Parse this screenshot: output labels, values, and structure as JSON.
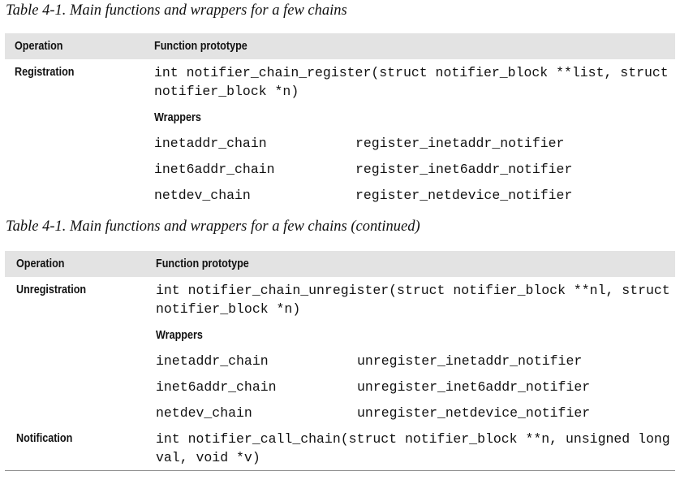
{
  "table1": {
    "caption": "Table 4-1. Main functions and wrappers for a few chains",
    "header": {
      "operation": "Operation",
      "prototype": "Function prototype"
    },
    "rows": [
      {
        "operation": "Registration",
        "prototype_line1": "int notifier_chain_register(struct notifier_block **list, struct",
        "prototype_line2": "notifier_block *n)",
        "wrappers_label": "Wrappers",
        "wrappers": [
          {
            "chain": "inetaddr_chain",
            "function": "register_inetaddr_notifier"
          },
          {
            "chain": "inet6addr_chain",
            "function": "register_inet6addr_notifier"
          },
          {
            "chain": "netdev_chain",
            "function": "register_netdevice_notifier"
          }
        ]
      }
    ]
  },
  "table2": {
    "caption": "Table 4-1. Main functions and wrappers for a few chains (continued)",
    "header": {
      "operation": "Operation",
      "prototype": "Function prototype"
    },
    "rows": [
      {
        "operation": "Unregistration",
        "prototype_line1": "int notifier_chain_unregister(struct notifier_block **nl, struct",
        "prototype_line2": "notifier_block *n)",
        "wrappers_label": "Wrappers",
        "wrappers": [
          {
            "chain": "inetaddr_chain",
            "function": "unregister_inetaddr_notifier"
          },
          {
            "chain": "inet6addr_chain",
            "function": "unregister_inet6addr_notifier"
          },
          {
            "chain": "netdev_chain",
            "function": "unregister_netdevice_notifier"
          }
        ]
      },
      {
        "operation": "Notification",
        "prototype_line1": "int notifier_call_chain(struct notifier_block **n, unsigned long",
        "prototype_line2": "val, void *v)"
      }
    ]
  }
}
